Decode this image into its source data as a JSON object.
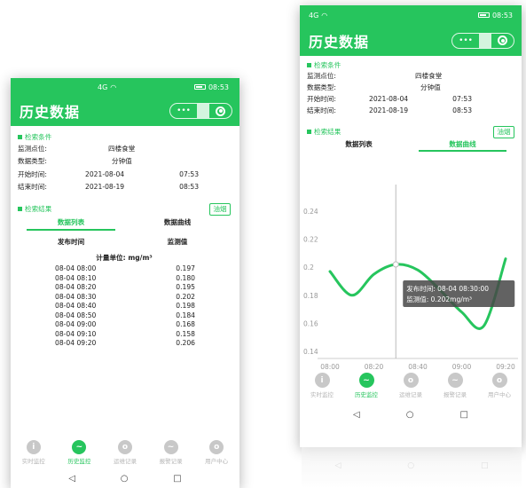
{
  "status_bar": {
    "signal": "4G",
    "time": "08:53"
  },
  "header": {
    "title": "历史数据",
    "menu_glyph": "•••"
  },
  "criteria": {
    "section_title": "检索条件",
    "location_label": "监测点位:",
    "location_value": "四楼食堂",
    "type_label": "数据类型:",
    "type_value": "分钟值",
    "start_label": "开始时间:",
    "start_date": "2021-08-04",
    "start_time": "07:53",
    "end_label": "结束时间:",
    "end_date": "2021-08-19",
    "end_time": "08:53"
  },
  "results": {
    "section_title": "检索结果",
    "reset_button": "油烟"
  },
  "tabs": {
    "list": "数据列表",
    "curve": "数据曲线"
  },
  "table": {
    "col_time": "发布时间",
    "col_value": "监测值",
    "unit": "计量单位: mg/m³",
    "rows": [
      {
        "time": "08-04 08:00",
        "value": "0.197"
      },
      {
        "time": "08-04 08:10",
        "value": "0.180"
      },
      {
        "time": "08-04 08:20",
        "value": "0.195"
      },
      {
        "time": "08-04 08:30",
        "value": "0.202"
      },
      {
        "time": "08-04 08:40",
        "value": "0.198"
      },
      {
        "time": "08-04 08:50",
        "value": "0.184"
      },
      {
        "time": "08-04 09:00",
        "value": "0.168"
      },
      {
        "time": "08-04 09:10",
        "value": "0.158"
      },
      {
        "time": "08-04 09:20",
        "value": "0.206"
      }
    ]
  },
  "nav": {
    "items": [
      {
        "label": "实时监控",
        "glyph": "i"
      },
      {
        "label": "历史监控",
        "glyph": "~"
      },
      {
        "label": "运维记录",
        "glyph": "o"
      },
      {
        "label": "报警记录",
        "glyph": "~"
      },
      {
        "label": "用户中心",
        "glyph": "o"
      }
    ]
  },
  "system_bar": {
    "back": "◁",
    "home": "○",
    "recent": "□"
  },
  "chart_data": {
    "type": "line",
    "x": [
      "08:00",
      "08:10",
      "08:20",
      "08:30",
      "08:40",
      "08:50",
      "09:00",
      "09:10",
      "09:20"
    ],
    "x_ticks": [
      "08:00",
      "08:20",
      "08:40",
      "09:00",
      "09:20"
    ],
    "values": [
      0.197,
      0.18,
      0.195,
      0.202,
      0.198,
      0.184,
      0.168,
      0.158,
      0.206
    ],
    "yticks": [
      "0.14",
      "0.16",
      "0.18",
      "0.2",
      "0.22",
      "0.24"
    ],
    "ylim": [
      0.14,
      0.24
    ],
    "color": "#26c55d",
    "tooltip": {
      "line1": "发布时间: 08-04 08:30:00",
      "line2": "监测值: 0.202mg/m³",
      "index": 3
    }
  },
  "colors": {
    "accent": "#26c55d"
  }
}
